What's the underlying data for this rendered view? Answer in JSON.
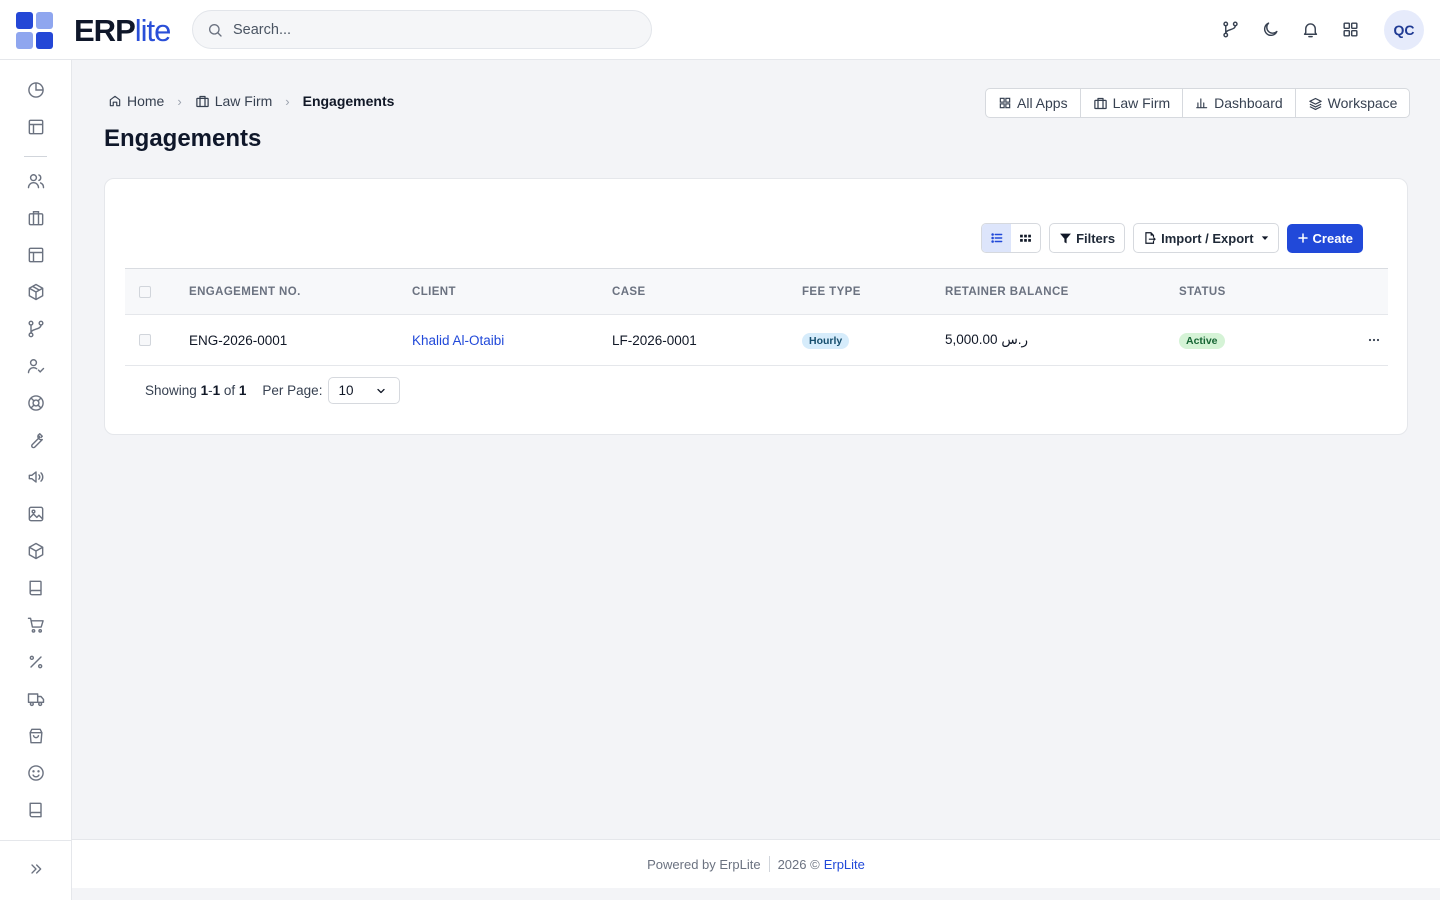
{
  "brand": {
    "name_bold": "ERP",
    "name_light": "lite",
    "colors": {
      "primary": "#2149d9",
      "logo_dark": "#2447d6",
      "logo_light": "#8fa6ef"
    }
  },
  "search": {
    "placeholder": "Search..."
  },
  "header_icons": [
    "git-branch-icon",
    "moon-icon",
    "bell-icon",
    "apps-grid-icon"
  ],
  "user": {
    "initials": "QC"
  },
  "sidebar": {
    "items": [
      "chart-pie-icon",
      "layout-icon",
      "users-icon",
      "briefcase-icon",
      "layout-icon",
      "package-icon",
      "git-branch-icon",
      "user-check-icon",
      "lifebuoy-icon",
      "tool-icon",
      "speaker-icon",
      "image-icon",
      "box-icon",
      "book-icon",
      "cart-icon",
      "percent-icon",
      "truck-icon",
      "shopping-bag-icon",
      "smile-icon",
      "book-icon"
    ]
  },
  "breadcrumb": {
    "home": "Home",
    "module": "Law Firm",
    "current": "Engagements"
  },
  "page": {
    "title": "Engagements"
  },
  "app_links": {
    "all_apps": "All Apps",
    "law_firm": "Law Firm",
    "dashboard": "Dashboard",
    "workspace": "Workspace"
  },
  "toolbar": {
    "filters": "Filters",
    "import_export": "Import / Export",
    "create": "Create"
  },
  "table": {
    "columns": {
      "number": "ENGAGEMENT NO.",
      "client": "CLIENT",
      "case": "CASE",
      "fee_type": "FEE TYPE",
      "retainer": "RETAINER BALANCE",
      "status": "STATUS"
    },
    "rows": [
      {
        "number": "ENG-2026-0001",
        "client": "Khalid Al-Otaibi",
        "case": "LF-2026-0001",
        "fee_type": "Hourly",
        "retainer": "5,000.00 ر.س",
        "status": "Active"
      }
    ]
  },
  "pagination": {
    "showing": "Showing",
    "range_start": "1",
    "dash": "-",
    "range_end": "1",
    "of": "of",
    "total": "1",
    "per_page_label": "Per Page:",
    "per_page_value": "10"
  },
  "footer": {
    "powered": "Powered by ErpLite",
    "copyright": "2026 ©",
    "link": "ErpLite"
  }
}
